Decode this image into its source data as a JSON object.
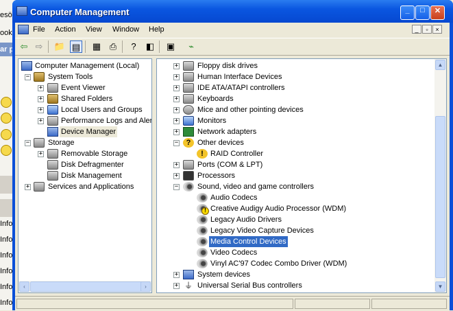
{
  "background": {
    "fragments": [
      "esök",
      "ook",
      "ar p",
      "Info",
      "Info",
      "Info",
      "Info",
      "Info",
      "Info"
    ]
  },
  "window": {
    "title": "Computer Management",
    "controls": {
      "minimize": "_",
      "maximize": "□",
      "close": "✕"
    }
  },
  "menu": {
    "items": [
      "File",
      "Action",
      "View",
      "Window",
      "Help"
    ],
    "mdi_controls": [
      "_",
      "▫",
      "×"
    ]
  },
  "toolbar": {
    "icons": [
      "back-icon",
      "forward-icon",
      "up-folder-icon",
      "show-hide-tree-icon",
      "properties-icon",
      "print-icon",
      "help-icon",
      "console-icon",
      "scan-hardware-icon",
      "uninstall-icon"
    ]
  },
  "tree": {
    "items": [
      {
        "label": "Computer Management (Local)",
        "expander": "−",
        "icon": "computer-icon"
      },
      {
        "label": "System Tools",
        "expander": "−",
        "icon": "tools-icon"
      },
      {
        "label": "Event Viewer",
        "expander": "+",
        "icon": "event-viewer-icon"
      },
      {
        "label": "Shared Folders",
        "expander": "+",
        "icon": "shared-folders-icon"
      },
      {
        "label": "Local Users and Groups",
        "expander": "+",
        "icon": "users-icon"
      },
      {
        "label": "Performance Logs and Alerts",
        "expander": "+",
        "icon": "performance-icon"
      },
      {
        "label": "Device Manager",
        "expander": "",
        "icon": "device-manager-icon"
      },
      {
        "label": "Storage",
        "expander": "−",
        "icon": "storage-icon"
      },
      {
        "label": "Removable Storage",
        "expander": "+",
        "icon": "removable-storage-icon"
      },
      {
        "label": "Disk Defragmenter",
        "expander": "",
        "icon": "defrag-icon"
      },
      {
        "label": "Disk Management",
        "expander": "",
        "icon": "disk-management-icon"
      },
      {
        "label": "Services and Applications",
        "expander": "+",
        "icon": "services-icon"
      }
    ],
    "scroll": {
      "left": "‹",
      "right": "›"
    }
  },
  "devices": {
    "items": [
      {
        "label": "Floppy disk drives",
        "expander": "+",
        "icon": "floppy-icon"
      },
      {
        "label": "Human Interface Devices",
        "expander": "+",
        "icon": "hid-icon"
      },
      {
        "label": "IDE ATA/ATAPI controllers",
        "expander": "+",
        "icon": "ide-icon"
      },
      {
        "label": "Keyboards",
        "expander": "+",
        "icon": "keyboard-icon"
      },
      {
        "label": "Mice and other pointing devices",
        "expander": "+",
        "icon": "mouse-icon"
      },
      {
        "label": "Monitors",
        "expander": "+",
        "icon": "monitor-icon"
      },
      {
        "label": "Network adapters",
        "expander": "+",
        "icon": "network-icon"
      },
      {
        "label": "Other devices",
        "expander": "−",
        "icon": "unknown-device-icon"
      },
      {
        "label": "RAID Controller",
        "expander": "",
        "icon": "warning-device-icon"
      },
      {
        "label": "Ports (COM & LPT)",
        "expander": "+",
        "icon": "port-icon"
      },
      {
        "label": "Processors",
        "expander": "+",
        "icon": "processor-icon"
      },
      {
        "label": "Sound, video and game controllers",
        "expander": "−",
        "icon": "speaker-icon"
      },
      {
        "label": "Audio Codecs",
        "expander": "",
        "icon": "speaker-icon"
      },
      {
        "label": "Creative Audigy Audio Processor (WDM)",
        "expander": "",
        "icon": "speaker-warning-icon"
      },
      {
        "label": "Legacy Audio Drivers",
        "expander": "",
        "icon": "speaker-icon"
      },
      {
        "label": "Legacy Video Capture Devices",
        "expander": "",
        "icon": "speaker-icon"
      },
      {
        "label": "Media Control Devices",
        "expander": "",
        "icon": "speaker-icon"
      },
      {
        "label": "Video Codecs",
        "expander": "",
        "icon": "speaker-icon"
      },
      {
        "label": "Vinyl AC'97 Codec Combo Driver (WDM)",
        "expander": "",
        "icon": "speaker-icon"
      },
      {
        "label": "System devices",
        "expander": "+",
        "icon": "system-devices-icon"
      },
      {
        "label": "Universal Serial Bus controllers",
        "expander": "+",
        "icon": "usb-icon"
      }
    ],
    "selected": "Media Control Devices",
    "scroll": {
      "up": "▲",
      "down": "▼"
    }
  },
  "colors": {
    "selection": "#316ac5",
    "titlebar": "#0a56e0",
    "chrome": "#ece9d8"
  }
}
